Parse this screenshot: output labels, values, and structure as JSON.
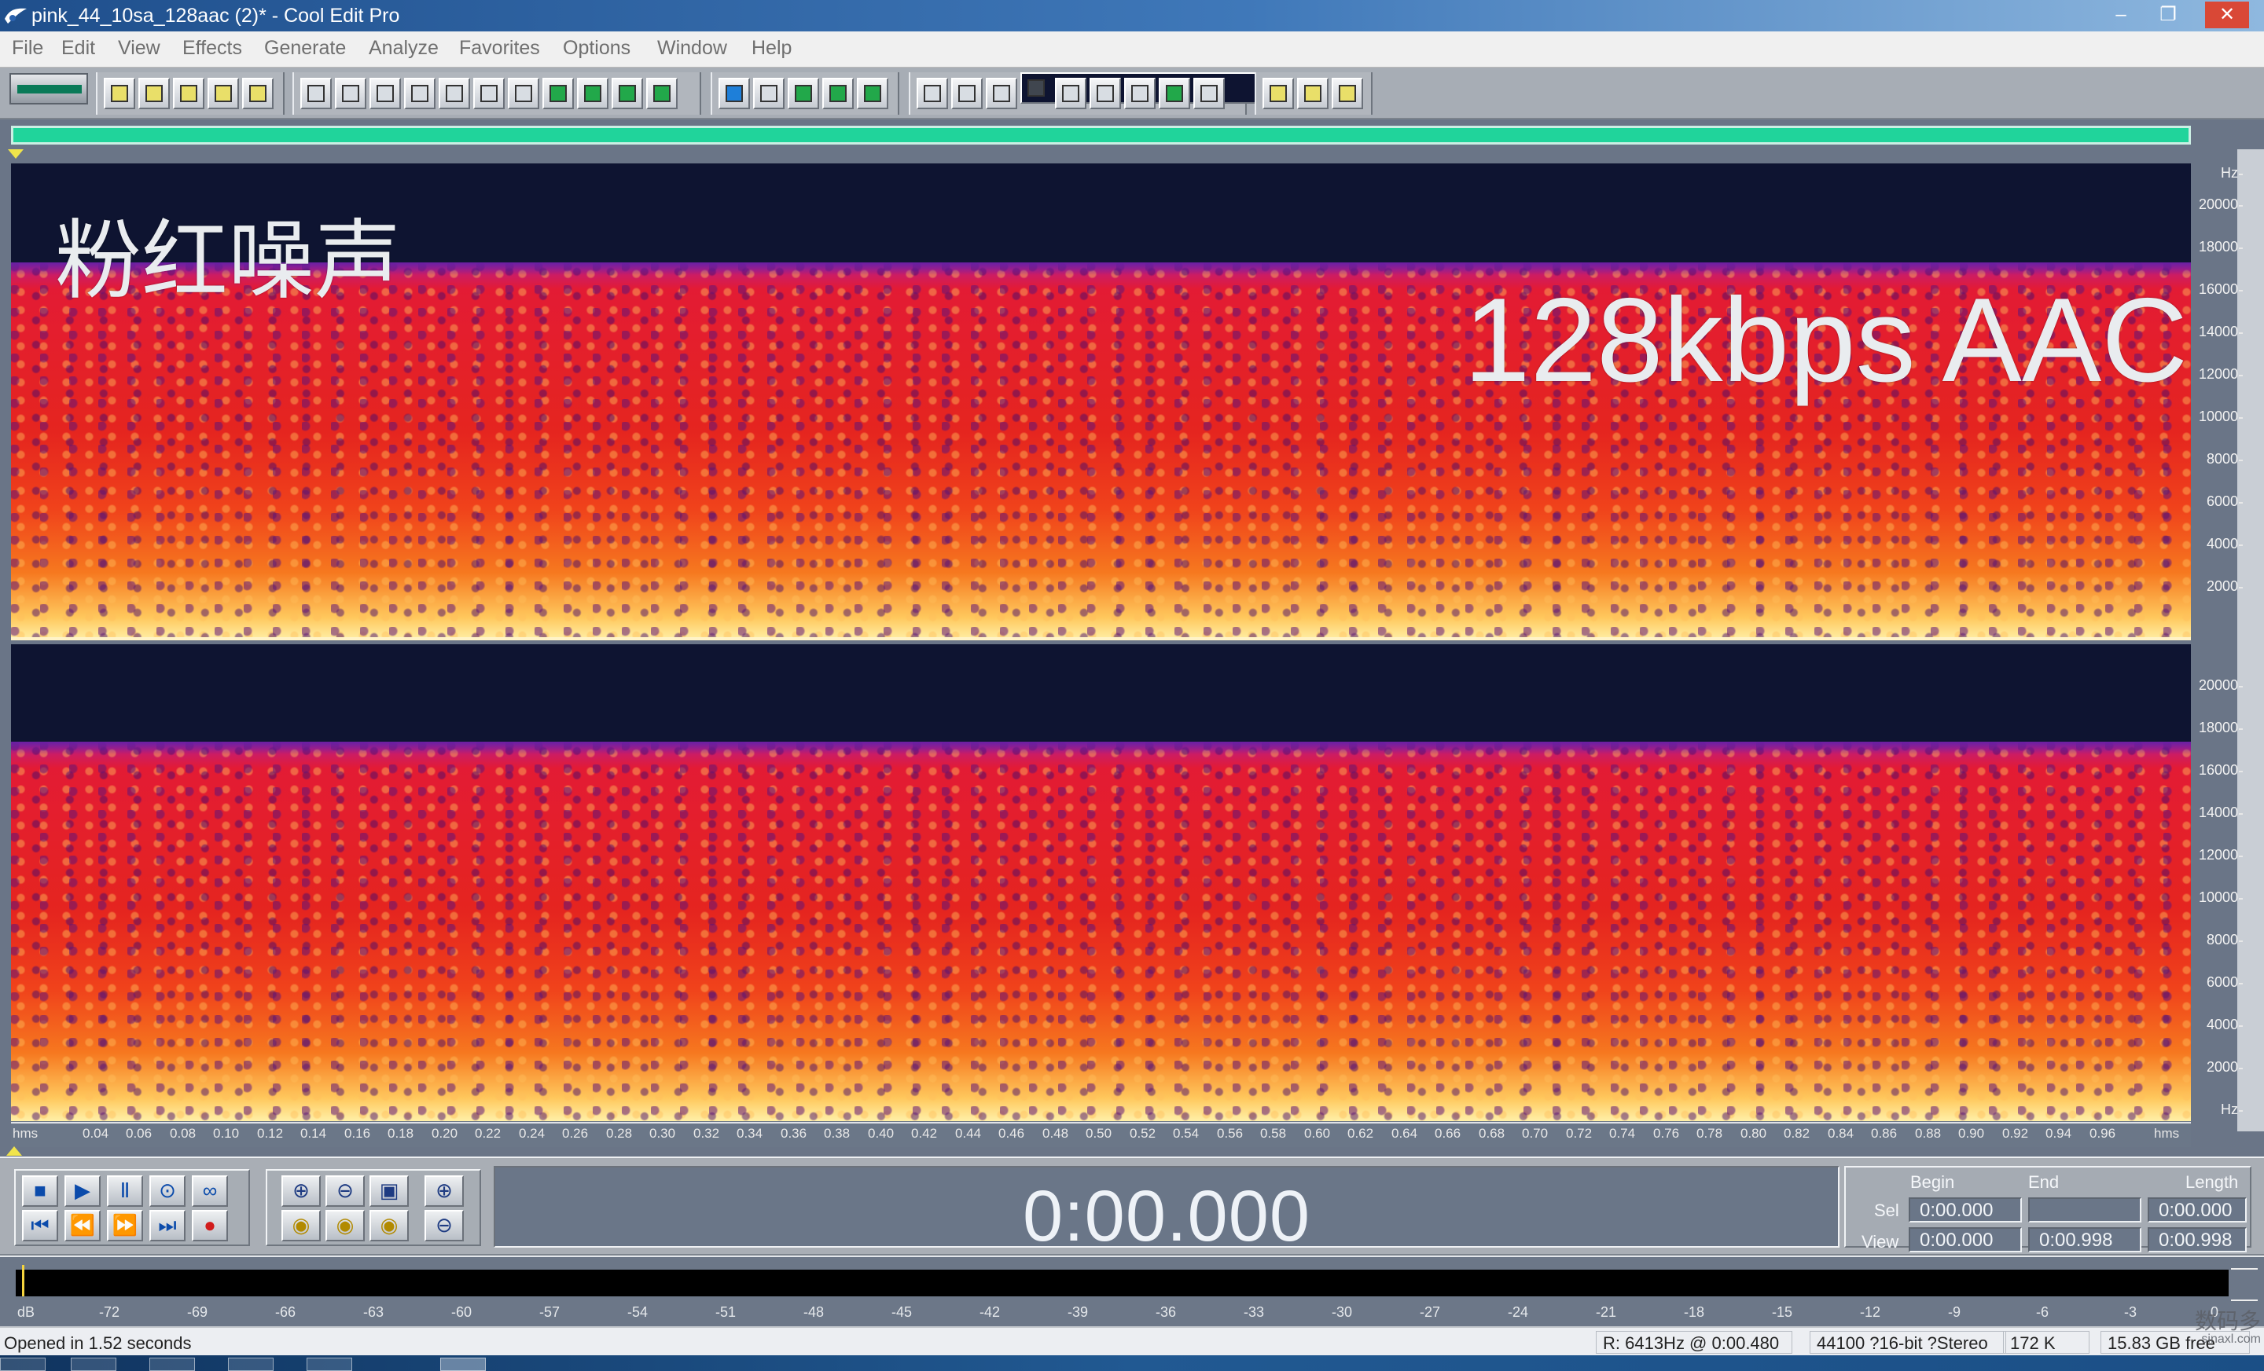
{
  "window": {
    "title": "pink_44_10sa_128aac (2)* - Cool Edit Pro",
    "controls": [
      "–",
      "❐",
      "✕"
    ]
  },
  "menu": [
    "File",
    "Edit",
    "View",
    "Effects",
    "Generate",
    "Analyze",
    "Favorites",
    "Options",
    "Window",
    "Help"
  ],
  "tracks": {
    "overlay_cn": "粉红噪声",
    "overlay_en": "128kbps AAC",
    "hz_label": "Hz",
    "freq_ticks": [
      "20000",
      "18000",
      "16000",
      "14000",
      "12000",
      "10000",
      "8000",
      "6000",
      "4000",
      "2000"
    ]
  },
  "timeline": {
    "label": "hms",
    "ticks": [
      "0.04",
      "0.06",
      "0.08",
      "0.10",
      "0.12",
      "0.14",
      "0.16",
      "0.18",
      "0.20",
      "0.22",
      "0.24",
      "0.26",
      "0.28",
      "0.30",
      "0.32",
      "0.34",
      "0.36",
      "0.38",
      "0.40",
      "0.42",
      "0.44",
      "0.46",
      "0.48",
      "0.50",
      "0.52",
      "0.54",
      "0.56",
      "0.58",
      "0.60",
      "0.62",
      "0.64",
      "0.66",
      "0.68",
      "0.70",
      "0.72",
      "0.74",
      "0.76",
      "0.78",
      "0.80",
      "0.82",
      "0.84",
      "0.86",
      "0.88",
      "0.90",
      "0.92",
      "0.94",
      "0.96"
    ],
    "end_label": "hms"
  },
  "transport": {
    "buttons_top": [
      "■",
      "▶",
      "Ⅱ",
      "⊙",
      "∞"
    ],
    "buttons_bottom": [
      "⏮",
      "⏪",
      "⏩",
      "⏭",
      "●"
    ],
    "zoom_top": [
      "⊕",
      "⊖",
      "▣",
      "⊕"
    ],
    "zoom_bottom": [
      "◉",
      "◉",
      "◉",
      "⊖"
    ],
    "time": "0:00.000"
  },
  "selection": {
    "begin_label": "Begin",
    "end_label": "End",
    "length_label": "Length",
    "sel_label": "Sel",
    "view_label": "View",
    "sel_begin": "0:00.000",
    "sel_end": "",
    "sel_length": "0:00.000",
    "view_begin": "0:00.000",
    "view_end": "0:00.998",
    "view_length": "0:00.998"
  },
  "levels": {
    "ticks": [
      "dB",
      "-72",
      "-69",
      "-66",
      "-63",
      "-60",
      "-57",
      "-54",
      "-51",
      "-48",
      "-45",
      "-42",
      "-39",
      "-36",
      "-33",
      "-30",
      "-27",
      "-24",
      "-21",
      "-18",
      "-15",
      "-12",
      "-9",
      "-6",
      "-3",
      "0"
    ]
  },
  "status": {
    "text": "Opened in 1.52 seconds",
    "cursor": "R: 6413Hz @  0:00.480",
    "format": "44100 ?16-bit ?Stereo",
    "size": "172 K",
    "free": "15.83 GB free"
  },
  "watermark": {
    "top": "数码多",
    "bottom": "sinaxl.com"
  }
}
